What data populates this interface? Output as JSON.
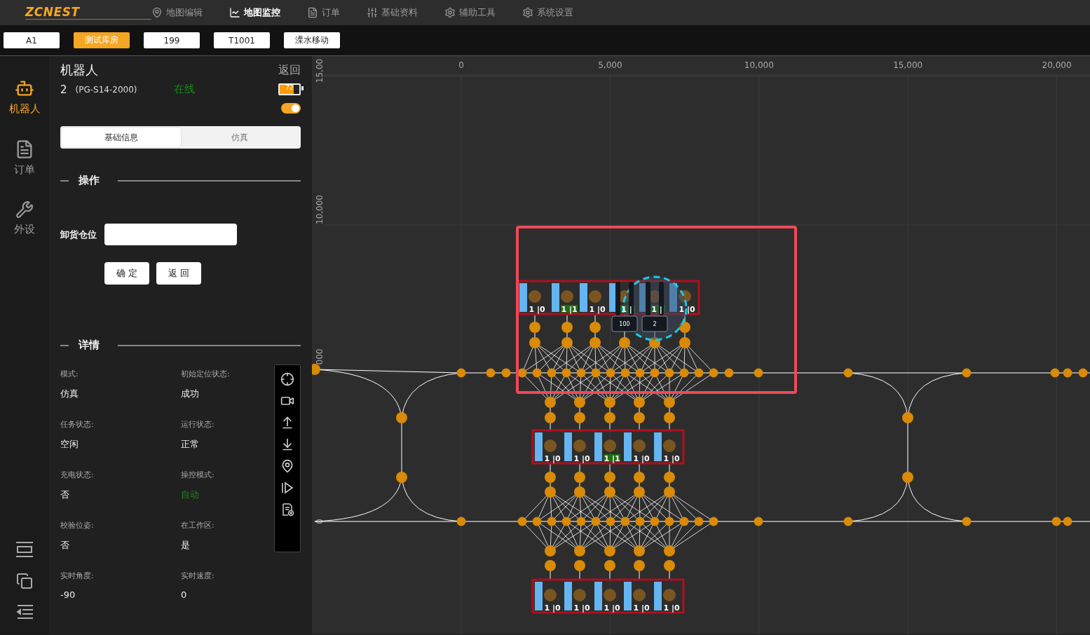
{
  "logo": "ZCNEST",
  "nav": [
    {
      "label": "地图编辑",
      "selected": false
    },
    {
      "label": "地图监控",
      "selected": true
    },
    {
      "label": "订单",
      "selected": false
    },
    {
      "label": "基础资料",
      "selected": false
    },
    {
      "label": "辅助工具",
      "selected": false
    },
    {
      "label": "系统设置",
      "selected": false
    }
  ],
  "chips": [
    {
      "label": "A1",
      "selected": false
    },
    {
      "label": "测试库房",
      "selected": true
    },
    {
      "label": "199",
      "selected": false
    },
    {
      "label": "T1001",
      "selected": false
    },
    {
      "label": "溧水移动",
      "selected": false
    }
  ],
  "side_nav": [
    {
      "label": "机器人",
      "selected": true
    },
    {
      "label": "订单",
      "selected": false
    },
    {
      "label": "外设",
      "selected": false
    }
  ],
  "robot_panel": {
    "title": "机器人",
    "back": "返回",
    "robot_id": "2",
    "model": "(PG-S14-2000)",
    "status": "在线",
    "online": true,
    "battery": {
      "label": "72",
      "level": 0.72
    },
    "enabled": true,
    "tabs": [
      {
        "label": "基础信息",
        "selected": true
      },
      {
        "label": "仿真",
        "selected": false
      }
    ],
    "operation": {
      "heading": "操作",
      "field_label": "卸货仓位",
      "buttons": [
        "确 定",
        "返 回"
      ]
    },
    "details": {
      "heading": "详情",
      "items": [
        {
          "label": "模式:",
          "value": "仿真",
          "kind": "plain"
        },
        {
          "label": "初始定位状态:",
          "value": "成功",
          "kind": "plain"
        },
        {
          "label": "任务状态:",
          "value": "空闲",
          "kind": "plain"
        },
        {
          "label": "运行状态:",
          "value": "正常",
          "kind": "plain"
        },
        {
          "label": "充电状态:",
          "value": "否",
          "kind": "plain"
        },
        {
          "label": "操控模式:",
          "value": "自动",
          "kind": "ok"
        },
        {
          "label": "校验位姿:",
          "value": "否",
          "kind": "plain"
        },
        {
          "label": "在工作区:",
          "value": "是",
          "kind": "plain"
        },
        {
          "label": "实时角度:",
          "value": "-90",
          "kind": "plain"
        },
        {
          "label": "实时速度:",
          "value": "0",
          "kind": "plain"
        }
      ]
    }
  },
  "map": {
    "x_ticks": [
      "0",
      "5,000",
      "10,000",
      "15,000",
      "20,000"
    ],
    "y_ticks": [
      "15,00",
      "10,000",
      "000",
      "0"
    ],
    "station_rows": [
      {
        "slots": [
          {
            "status": "1 |0",
            "occupied": false
          },
          {
            "status": "1 |1",
            "occupied": true
          },
          {
            "status": "1 |0",
            "occupied": false
          },
          {
            "status": "1 |",
            "occupied": true
          },
          {
            "status": "1 |",
            "occupied": true
          },
          {
            "status": "1 |0",
            "occupied": false
          }
        ]
      },
      {
        "slots": [
          {
            "status": "1 |0",
            "occupied": false
          },
          {
            "status": "1 |0",
            "occupied": false
          },
          {
            "status": "1 |1",
            "occupied": true
          },
          {
            "status": "1 |0",
            "occupied": false
          },
          {
            "status": "1 |0",
            "occupied": false
          }
        ]
      },
      {
        "slots": [
          {
            "status": "1 |0",
            "occupied": false
          },
          {
            "status": "1 |0",
            "occupied": false
          },
          {
            "status": "1 |0",
            "occupied": false
          },
          {
            "status": "1 |0",
            "occupied": false
          },
          {
            "status": "1 |0",
            "occupied": false
          }
        ]
      }
    ],
    "robots": [
      {
        "label": "100"
      },
      {
        "label": "2"
      }
    ]
  }
}
